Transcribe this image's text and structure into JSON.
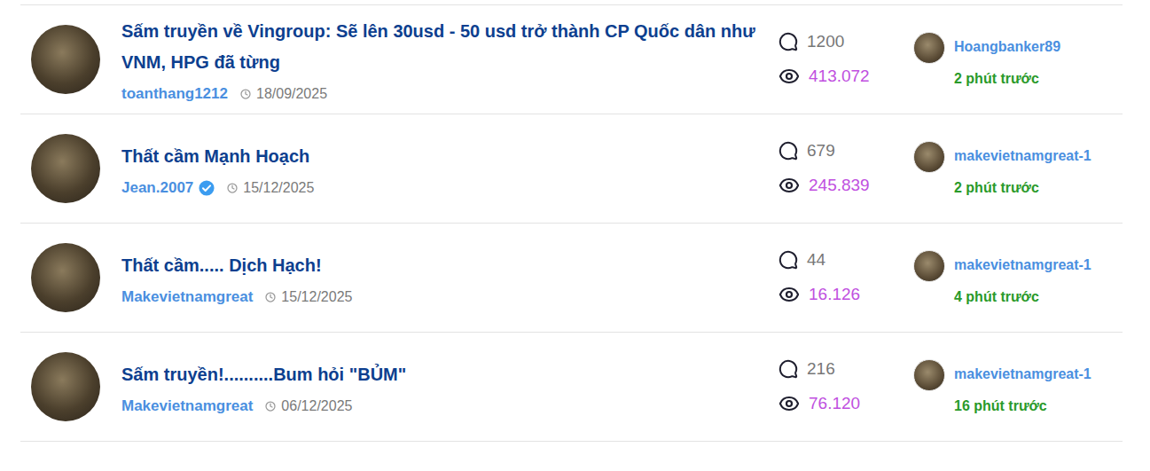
{
  "threads": [
    {
      "title": "Sấm truyền về Vingroup: Sẽ lên 30usd - 50 usd trở thành CP Quốc dân như VNM, HPG đã từng",
      "author": "toanthang1212",
      "verified": false,
      "date": "18/09/2025",
      "comments": "1200",
      "views": "413.072",
      "last_user": "Hoangbanker89",
      "last_time": "2 phút trước"
    },
    {
      "title": "Thất cầm Mạnh Hoạch",
      "author": "Jean.2007",
      "verified": true,
      "date": "15/12/2025",
      "comments": "679",
      "views": "245.839",
      "last_user": "makevietnamgreat-1",
      "last_time": "2 phút trước"
    },
    {
      "title": "Thất cầm..... Dịch Hạch!",
      "author": "Makevietnamgreat",
      "verified": false,
      "date": "15/12/2025",
      "comments": "44",
      "views": "16.126",
      "last_user": "makevietnamgreat-1",
      "last_time": "4 phút trước"
    },
    {
      "title": "Sấm truyền!..........Bum hỏi \"BỦM\"",
      "author": "Makevietnamgreat",
      "verified": false,
      "date": "06/12/2025",
      "comments": "216",
      "views": "76.120",
      "last_user": "makevietnamgreat-1",
      "last_time": "16 phút trước"
    }
  ]
}
